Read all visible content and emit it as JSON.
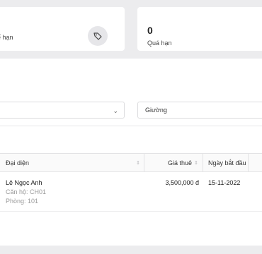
{
  "stats": [
    {
      "value": "",
      "label": "ế hạn"
    },
    {
      "value": "0",
      "label": "Quá hạn"
    }
  ],
  "filters": [
    {
      "value": ""
    },
    {
      "value": "Giường"
    }
  ],
  "table": {
    "columns": [
      "Đại diện",
      "Giá thuê",
      "Ngày bắt đầu"
    ],
    "rows": [
      {
        "name": "Lê Ngọc Anh",
        "apartment": "Căn hộ: CH01",
        "room": "Phòng: 101",
        "price": "3,500,000 đ",
        "start": "15-11-2022"
      }
    ]
  },
  "colors": {
    "background": "#ececee",
    "card": "#ffffff",
    "border": "#dcdcde",
    "muted": "#999999"
  }
}
